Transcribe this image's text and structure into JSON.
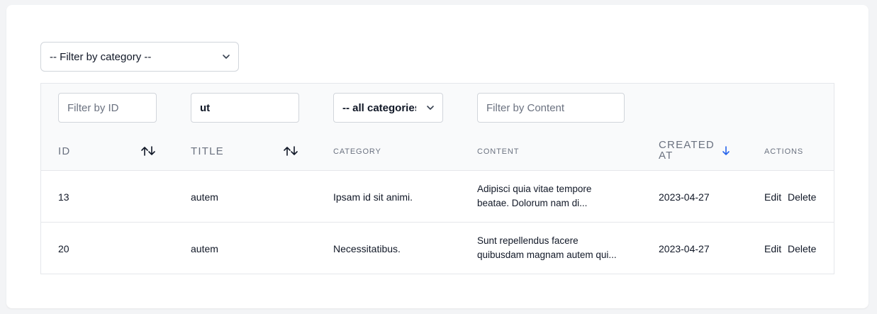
{
  "top_filter": {
    "label": "-- Filter by category --"
  },
  "filters": {
    "id_placeholder": "Filter by ID",
    "title_value": "ut",
    "category_select": "-- all categories --",
    "content_placeholder": "Filter by Content"
  },
  "columns": {
    "id": "ID",
    "title": "TITLE",
    "category": "CATEGORY",
    "content": "CONTENT",
    "created_at_line1": "CREATED",
    "created_at_line2": "AT",
    "actions": "ACTIONS"
  },
  "rows": [
    {
      "id": "13",
      "title": "autem",
      "category": "Ipsam id sit animi.",
      "content_line1": "Adipisci quia vitae tempore",
      "content_line2": "beatae. Dolorum nam di...",
      "created_at": "2023-04-27",
      "edit": "Edit",
      "delete": "Delete"
    },
    {
      "id": "20",
      "title": "autem",
      "category": "Necessitatibus.",
      "content_line1": "Sunt repellendus facere",
      "content_line2": "quibusdam magnam autem qui...",
      "created_at": "2023-04-27",
      "edit": "Edit",
      "delete": "Delete"
    }
  ],
  "colors": {
    "accent": "#2563eb",
    "border": "#e5e7eb",
    "header_bg": "#f9fafb"
  },
  "icons": {
    "sort": "sort-both-icon",
    "sort_desc": "arrow-down-icon",
    "dropdown": "chevron-down-icon"
  }
}
